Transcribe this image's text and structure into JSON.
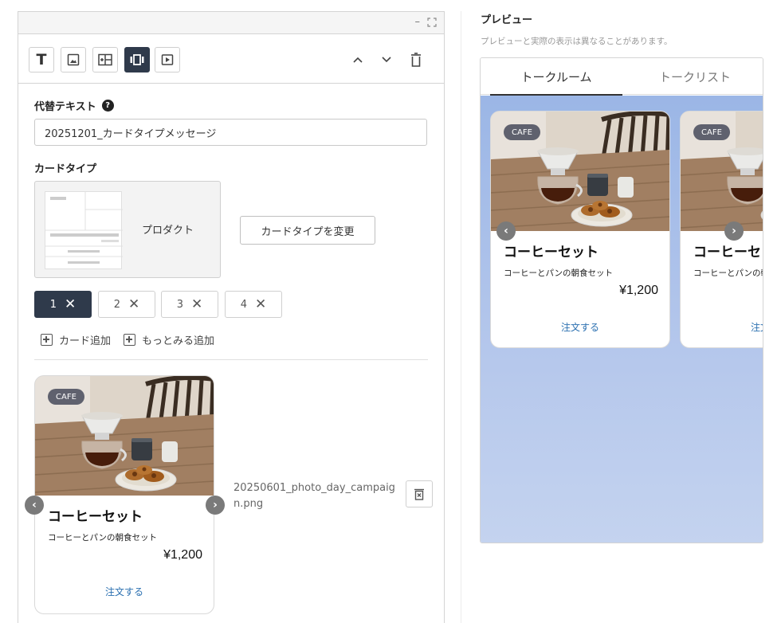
{
  "editor": {
    "window_controls": {
      "minimize": "–"
    },
    "toolbar": {
      "text_tool": "T"
    },
    "alt_text": {
      "label": "代替テキスト",
      "help": "?",
      "value": "20251201_カードタイプメッセージ"
    },
    "card_type": {
      "label": "カードタイプ",
      "name": "プロダクト",
      "change_label": "カードタイプを変更"
    },
    "card_tabs": [
      {
        "label": "1",
        "active": true
      },
      {
        "label": "2",
        "active": false
      },
      {
        "label": "3",
        "active": false
      },
      {
        "label": "4",
        "active": false
      }
    ],
    "add_card_label": "カード追加",
    "add_more_label": "もっとみる追加",
    "file_name": "20250601_photo_day_campaign.png"
  },
  "card": {
    "badge": "CAFE",
    "title": "コーヒーセット",
    "description": "コーヒーとパンの朝食セット",
    "price": "¥1,200",
    "action": "注文する"
  },
  "preview": {
    "title": "プレビュー",
    "note": "プレビューと実際の表示は異なることがあります。",
    "tabs": [
      {
        "label": "トークルーム",
        "active": true
      },
      {
        "label": "トークリスト",
        "active": false
      }
    ]
  },
  "colors": {
    "primary_dark": "#2f3a4b",
    "link_blue": "#2a6fb0",
    "chat_background": "#a9bfe9"
  }
}
